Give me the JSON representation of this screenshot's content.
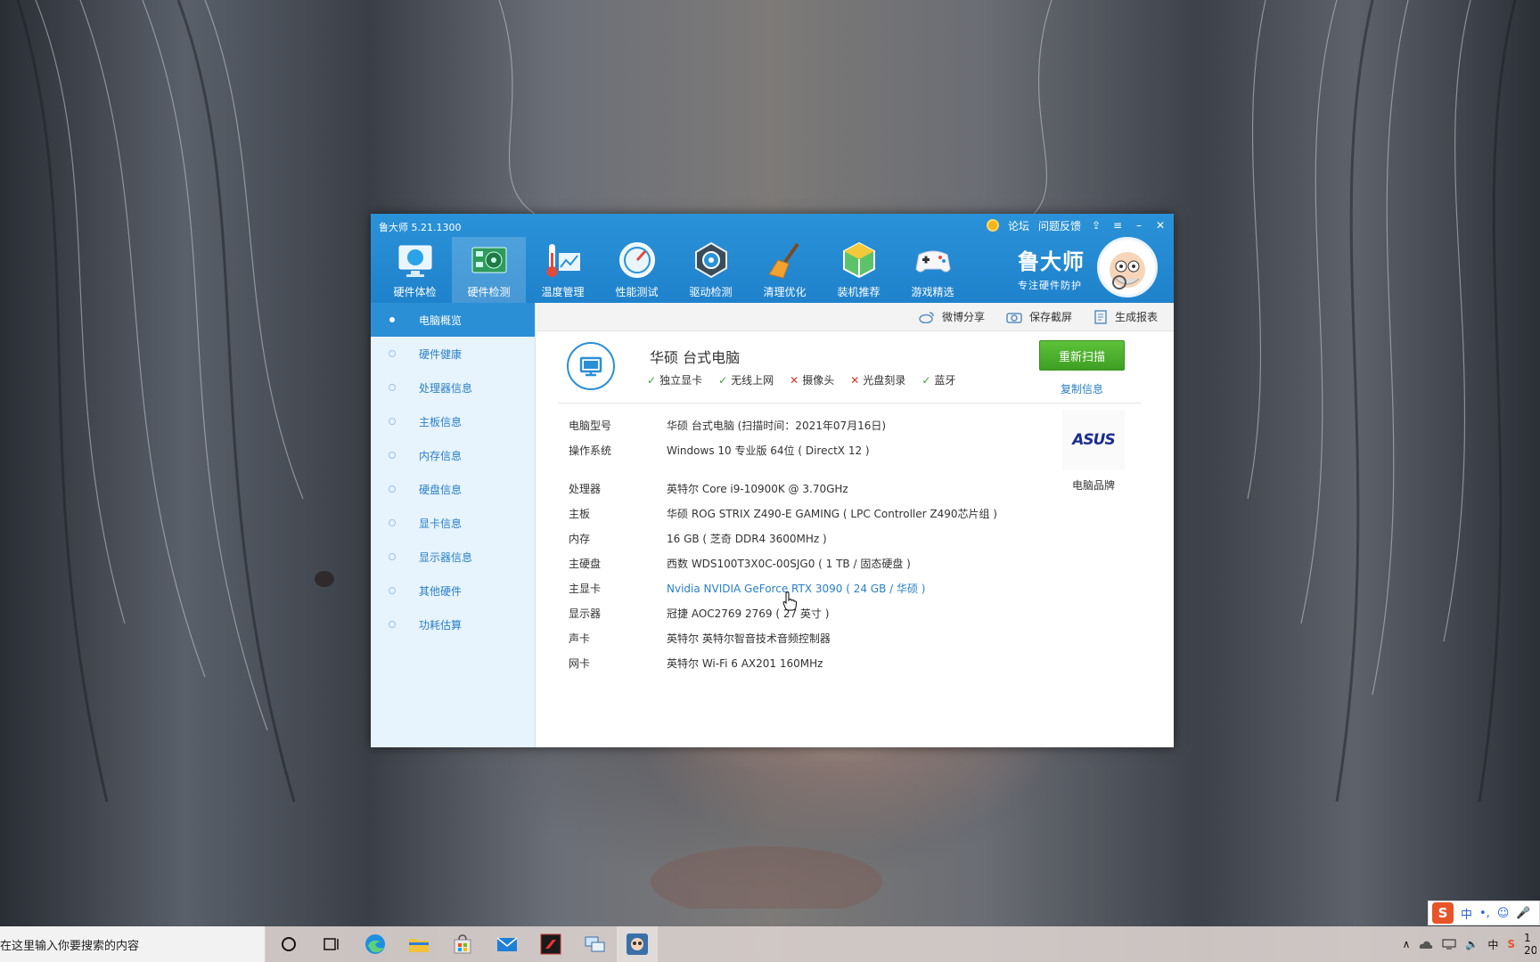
{
  "app": {
    "title": "鲁大师 5.21.1300",
    "top_links": {
      "forum": "论坛",
      "feedback": "问题反馈"
    },
    "brand": {
      "name": "鲁大师",
      "slogan": "专注硬件防护"
    }
  },
  "nav": [
    {
      "label": "硬件体检",
      "icon": "monitor-health-icon"
    },
    {
      "label": "硬件检测",
      "icon": "circuit-board-icon"
    },
    {
      "label": "温度管理",
      "icon": "thermometer-icon"
    },
    {
      "label": "性能测试",
      "icon": "speedometer-icon"
    },
    {
      "label": "驱动检测",
      "icon": "driver-gear-icon"
    },
    {
      "label": "清理优化",
      "icon": "broom-icon"
    },
    {
      "label": "装机推荐",
      "icon": "cube-icon"
    },
    {
      "label": "游戏精选",
      "icon": "gamepad-icon"
    }
  ],
  "sidebar": [
    {
      "label": "电脑概览"
    },
    {
      "label": "硬件健康"
    },
    {
      "label": "处理器信息"
    },
    {
      "label": "主板信息"
    },
    {
      "label": "内存信息"
    },
    {
      "label": "硬盘信息"
    },
    {
      "label": "显卡信息"
    },
    {
      "label": "显示器信息"
    },
    {
      "label": "其他硬件"
    },
    {
      "label": "功耗估算"
    }
  ],
  "toolbar": {
    "weibo_share": "微博分享",
    "save_screenshot": "保存截屏",
    "generate_report": "生成报表"
  },
  "summary": {
    "title": "华硕 台式电脑",
    "features": [
      {
        "label": "独立显卡",
        "ok": true
      },
      {
        "label": "无线上网",
        "ok": true
      },
      {
        "label": "摄像头",
        "ok": false
      },
      {
        "label": "光盘刻录",
        "ok": false
      },
      {
        "label": "蓝牙",
        "ok": true
      }
    ],
    "rescan_label": "重新扫描",
    "copy_label": "复制信息"
  },
  "specs": [
    {
      "key": "电脑型号",
      "value": "华硕 台式电脑  (扫描时间：2021年07月16日)"
    },
    {
      "key": "操作系统",
      "value": "Windows 10 专业版 64位 ( DirectX 12 )"
    },
    {
      "key": "处理器",
      "value": "英特尔 Core i9-10900K @ 3.70GHz"
    },
    {
      "key": "主板",
      "value": "华硕 ROG STRIX Z490-E GAMING ( LPC Controller Z490芯片组 )"
    },
    {
      "key": "内存",
      "value": "16 GB ( 芝奇 DDR4 3600MHz )"
    },
    {
      "key": "主硬盘",
      "value": "西数 WDS100T3X0C-00SJG0 ( 1 TB / 固态硬盘 )"
    },
    {
      "key": "主显卡",
      "value": "Nvidia NVIDIA GeForce RTX 3090 ( 24 GB / 华硕 )"
    },
    {
      "key": "显示器",
      "value": "冠捷 AOC2769 2769 ( 27 英寸 )"
    },
    {
      "key": "声卡",
      "value": "英特尔 英特尔智音技术音频控制器"
    },
    {
      "key": "网卡",
      "value": "英特尔 Wi-Fi 6 AX201 160MHz"
    }
  ],
  "brand_logo": {
    "text": "ASUS",
    "label": "电脑品牌"
  },
  "taskbar": {
    "search_placeholder": "在这里输入你要搜索的内容",
    "tray_lang": "中",
    "clock_partial_top": "1",
    "clock_partial_bottom": "20"
  },
  "ime": {
    "logo": "S",
    "mode": "中",
    "punct": "•,",
    "emoji": "☺",
    "mic": "🎤"
  },
  "colors": {
    "header": "#2a92d8",
    "accent": "#2b8fd6",
    "rescan": "#4eb02e",
    "link": "#2a80c4"
  }
}
